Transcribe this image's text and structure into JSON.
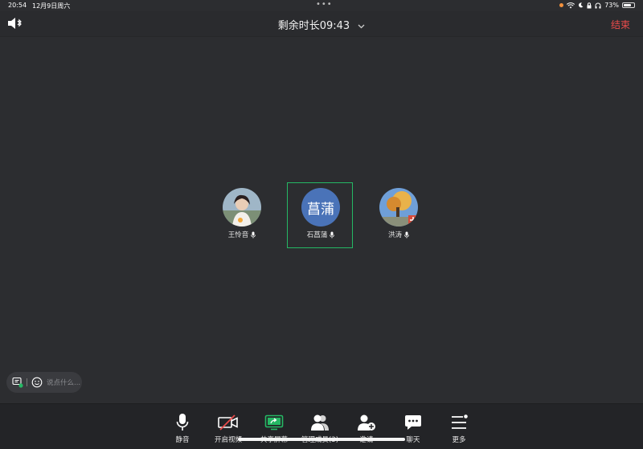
{
  "status": {
    "time": "20:54",
    "date": "12月9日周六",
    "dots": "•••",
    "battery_text": "73%",
    "battery_level": 0.73,
    "icons": [
      "orange-dot-icon",
      "wifi-icon",
      "moon-icon",
      "lock-icon",
      "headphones-icon"
    ]
  },
  "header": {
    "title": "剩余时长09:43",
    "end_label": "结束",
    "colors": {
      "end": "#ea4b4b"
    }
  },
  "participants": [
    {
      "name": "王怜音",
      "avatar": "photo",
      "muted": false
    },
    {
      "name": "石菖蒲",
      "avatar_text": "菖蒲",
      "avatar": "text",
      "active": true,
      "muted": false
    },
    {
      "name": "洪涛",
      "avatar": "photo",
      "muted": false
    }
  ],
  "chat": {
    "placeholder": "说点什么..."
  },
  "toolbar": {
    "mute": "静音",
    "video": "开启视频",
    "share": "共享屏幕",
    "members": "管理成员(3)",
    "invite": "邀请",
    "chat": "聊天",
    "more": "更多"
  },
  "colors": {
    "active_border": "#25b864",
    "share_green": "#25b864",
    "video_off_red": "#ea4b4b",
    "avatar_blue": "#4a73b8"
  }
}
